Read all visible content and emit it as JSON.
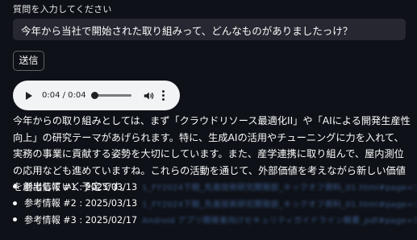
{
  "question": {
    "label": "質問を入力してください",
    "value": "今年から当社で開始された取り組みって、どんなものがありましたっけ？"
  },
  "send_label": "送信",
  "audio": {
    "time": "0:04 / 0:04",
    "progress": 0
  },
  "answer": "今年からの取り組みとしては、まず「クラウドリソース最適化II」や「AIによる開発生産性向上」の研究テーマがあげられます。特に、生成AIの活用やチューニングに力を入れて、実務の事業に貢献する姿勢を大切にしています。また、産学連携に取り組んで、屋内測位の応用なども進めていますね。これらの活動を通じて、外部価値を考えながら新しい価値を創出していく予定です。",
  "references": [
    {
      "label": "参考情報 #1 : 2025/03/13",
      "link": "1_FY2024下期_先進技術研究開発部_キックオフ資料_01.html#page=13"
    },
    {
      "label": "参考情報 #2 : 2025/03/13",
      "link": "1_FY2024下期_先進技術研究開発部_キックオフ資料_01.html#page=13"
    },
    {
      "label": "参考情報 #3 : 2025/02/17",
      "link": "Android アプリ開発者向けセキュリティガイドライン概要_pdf#page=11"
    }
  ],
  "colors": {
    "background": "#0e1117",
    "input_bg": "#262730",
    "link": "#3b5a8c"
  }
}
